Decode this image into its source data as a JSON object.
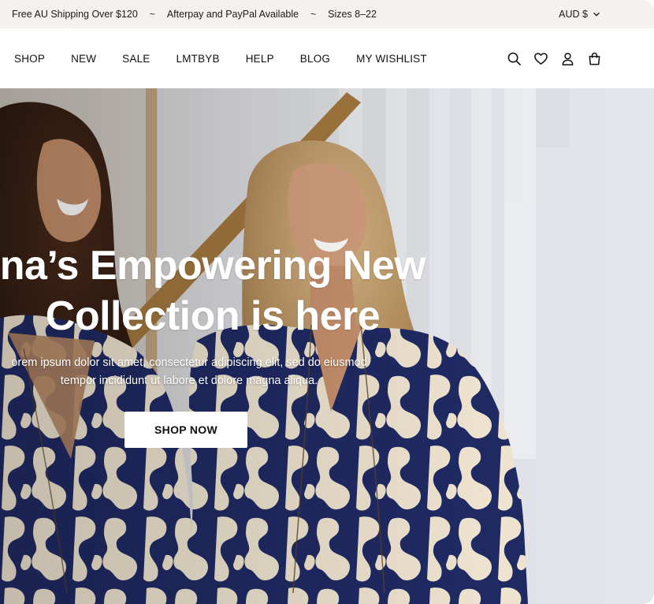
{
  "announcement": {
    "messages": [
      "Free AU Shipping Over $120",
      "Afterpay and PayPal Available",
      "Sizes 8–22"
    ],
    "separator": "~",
    "currency": "AUD $"
  },
  "nav": {
    "items": [
      "SHOP",
      "NEW",
      "SALE",
      "LMTBYB",
      "HELP",
      "BLOG",
      "MY WISHLIST"
    ]
  },
  "header_icons": [
    "search-icon",
    "heart-icon",
    "account-icon",
    "bag-icon"
  ],
  "hero": {
    "title_line1": "na’s Empowering New",
    "title_line2": "Collection is here",
    "body_line1": "orem ipsum dolor sit amet, consectetur adipiscing elit, sed do eiusmod",
    "body_line2": "tempor incididunt ut labore et dolore magna aliqua.",
    "cta_label": "SHOP NOW"
  },
  "colors": {
    "announcement_bg": "#f4f1ee",
    "dress_navy": "#1f2a63",
    "dress_cream": "#eee3cf"
  }
}
